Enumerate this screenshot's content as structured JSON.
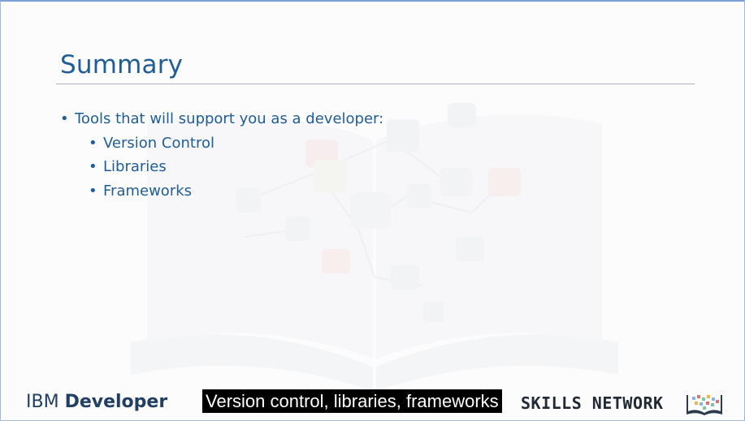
{
  "slide": {
    "title": "Summary",
    "bullets": [
      {
        "text": "Tools that will support you as a developer:",
        "children": [
          {
            "text": "Version Control"
          },
          {
            "text": "Libraries"
          },
          {
            "text": "Frameworks"
          }
        ]
      }
    ]
  },
  "footer": {
    "ibm_brand": "IBM",
    "ibm_product": "Developer",
    "skills_network": "SKILLS NETWORK"
  },
  "caption": {
    "text": "Version control, libraries, frameworks"
  },
  "colors": {
    "title": "#1f5d96",
    "bullet_text": "#1f5d96",
    "logo_ibm": "#223e63",
    "caption_bg": "#000000",
    "caption_text": "#ffffff"
  },
  "icons": {
    "watermark": "open-book-network-watermark",
    "skills_logo": "book-pixel-icon"
  }
}
